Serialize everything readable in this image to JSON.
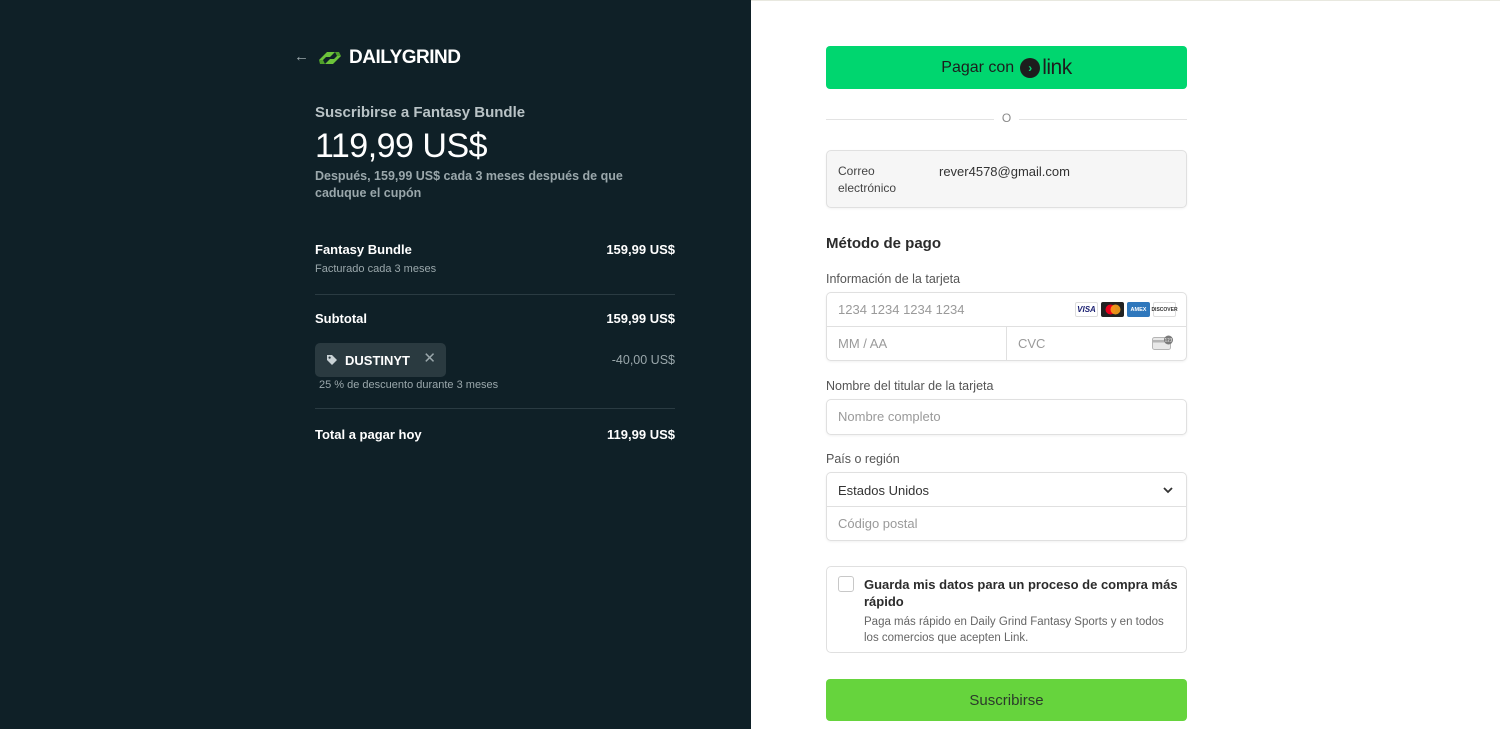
{
  "summary": {
    "brand": "DAILYGRIND",
    "subscribe_title": "Suscribirse a Fantasy Bundle",
    "price_today": "119,99 US$",
    "after_note": "Después, 159,99 US$ cada 3 meses después de que caduque el cupón",
    "item": {
      "name": "Fantasy Bundle",
      "price": "159,99 US$",
      "billing": "Facturado cada 3 meses"
    },
    "subtotal_label": "Subtotal",
    "subtotal_value": "159,99 US$",
    "coupon_code": "DUSTINYT",
    "coupon_remove": "✕",
    "discount_amount": "-40,00 US$",
    "discount_note": "25 % de descuento durante 3 meses",
    "total_label": "Total a pagar hoy",
    "total_value": "119,99 US$"
  },
  "checkout": {
    "link_button_label": "Pagar con",
    "link_word": "link",
    "or_text": "O",
    "email_label": "Correo electrónico",
    "email_value": "rever4578@gmail.com",
    "payment_method_title": "Método de pago",
    "card_info_label": "Información de la tarjeta",
    "card_number_placeholder": "1234 1234 1234 1234",
    "card_exp_placeholder": "MM / AA",
    "card_cvc_placeholder": "CVC",
    "card_brands": [
      "VISA",
      "mastercard",
      "AMEX",
      "DISCOVER"
    ],
    "cardholder_label": "Nombre del titular de la tarjeta",
    "cardholder_placeholder": "Nombre completo",
    "country_label": "País o región",
    "country_value": "Estados Unidos",
    "postal_placeholder": "Código postal",
    "save_title": "Guarda mis datos para un proceso de compra más rápido",
    "save_desc": "Paga más rápido en Daily Grind Fantasy Sports y en todos los comercios que acepten Link.",
    "save_checked": false,
    "subscribe_label": "Suscribirse"
  },
  "colors": {
    "left_bg": "#0f2027",
    "link_green": "#00d66f",
    "subscribe_green": "#66d43d",
    "brand_green": "#6cc33a"
  },
  "icons": {
    "back": "arrow-left-icon",
    "logo": "dailygrind-logo-icon",
    "tag": "tag-icon",
    "remove": "close-icon",
    "chevron": "chevron-down-icon",
    "cvc": "cvc-card-icon"
  }
}
